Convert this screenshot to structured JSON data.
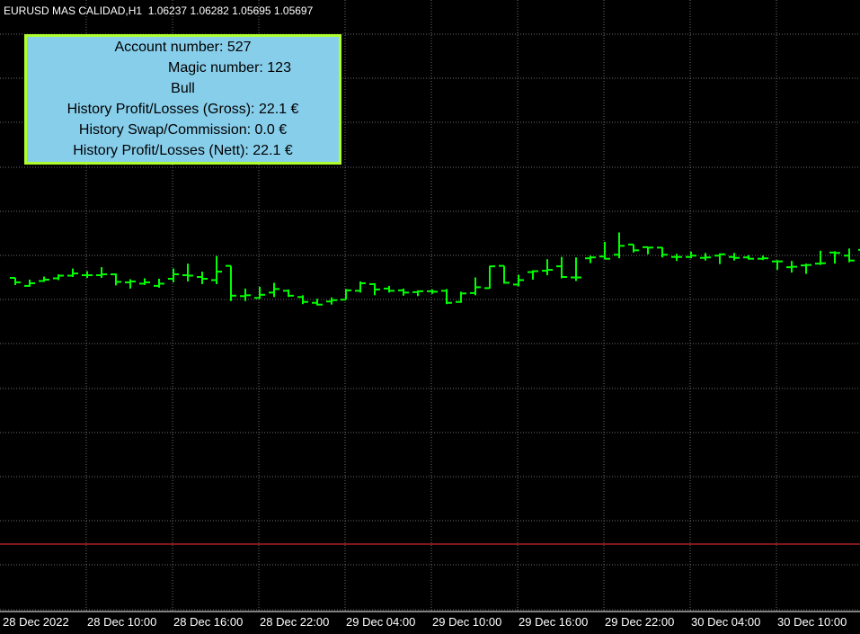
{
  "header": {
    "symbol_timeframe": "EURUSD MAS CALIDAD,H1",
    "open": "1.06237",
    "high": "1.06282",
    "low": "1.05695",
    "close": "1.05697"
  },
  "info_panel": {
    "lines": [
      "Account number: 527",
      "Magic number: 123",
      "Bull",
      "History Profit/Losses (Gross): 22.1 €",
      "History Swap/Commission: 0.0 €",
      "History Profit/Losses (Nett): 22.1 €"
    ]
  },
  "time_axis": {
    "labels": [
      "28 Dec 2022",
      "28 Dec 10:00",
      "28 Dec 16:00",
      "28 Dec 22:00",
      "29 Dec 04:00",
      "29 Dec 10:00",
      "29 Dec 16:00",
      "29 Dec 22:00",
      "30 Dec 04:00",
      "30 Dec 10:00"
    ]
  },
  "colors": {
    "background": "#000000",
    "bar": "#00ff00",
    "grid": "#6e6e6e",
    "text": "#ffffff",
    "panel_bg": "#87ceeb",
    "panel_border": "#adff2f",
    "price_line": "#ff3030"
  },
  "chart_data": {
    "type": "ohlc",
    "symbol": "EURUSD MAS CALIDAD",
    "timeframe": "H1",
    "bars": [
      {
        "o": 1.065,
        "h": 1.065,
        "l": 1.0634,
        "c": 1.064
      },
      {
        "o": 1.0632,
        "h": 1.0646,
        "l": 1.063,
        "c": 1.0638
      },
      {
        "o": 1.0643,
        "h": 1.0653,
        "l": 1.0641,
        "c": 1.0646
      },
      {
        "o": 1.0649,
        "h": 1.0658,
        "l": 1.0645,
        "c": 1.0655
      },
      {
        "o": 1.0655,
        "h": 1.0671,
        "l": 1.0652,
        "c": 1.066
      },
      {
        "o": 1.0656,
        "h": 1.0665,
        "l": 1.065,
        "c": 1.0656
      },
      {
        "o": 1.0656,
        "h": 1.0674,
        "l": 1.065,
        "c": 1.0658
      },
      {
        "o": 1.0658,
        "h": 1.066,
        "l": 1.0633,
        "c": 1.0641
      },
      {
        "o": 1.064,
        "h": 1.0647,
        "l": 1.0626,
        "c": 1.0642
      },
      {
        "o": 1.0637,
        "h": 1.0649,
        "l": 1.0634,
        "c": 1.064
      },
      {
        "o": 1.0632,
        "h": 1.0648,
        "l": 1.0628,
        "c": 1.0637
      },
      {
        "o": 1.0648,
        "h": 1.0671,
        "l": 1.064,
        "c": 1.0658
      },
      {
        "o": 1.0656,
        "h": 1.0682,
        "l": 1.0642,
        "c": 1.0655
      },
      {
        "o": 1.0652,
        "h": 1.0664,
        "l": 1.0636,
        "c": 1.0648
      },
      {
        "o": 1.0645,
        "h": 1.0699,
        "l": 1.0636,
        "c": 1.0664
      },
      {
        "o": 1.0677,
        "h": 1.0677,
        "l": 1.0598,
        "c": 1.061
      },
      {
        "o": 1.0609,
        "h": 1.0626,
        "l": 1.0598,
        "c": 1.0611
      },
      {
        "o": 1.0605,
        "h": 1.063,
        "l": 1.0603,
        "c": 1.0612
      },
      {
        "o": 1.0617,
        "h": 1.0639,
        "l": 1.0607,
        "c": 1.0625
      },
      {
        "o": 1.0621,
        "h": 1.0624,
        "l": 1.0607,
        "c": 1.061
      },
      {
        "o": 1.0607,
        "h": 1.0611,
        "l": 1.0591,
        "c": 1.0596
      },
      {
        "o": 1.0594,
        "h": 1.0603,
        "l": 1.0588,
        "c": 1.059
      },
      {
        "o": 1.0597,
        "h": 1.0606,
        "l": 1.059,
        "c": 1.06
      },
      {
        "o": 1.0601,
        "h": 1.0625,
        "l": 1.0601,
        "c": 1.0622
      },
      {
        "o": 1.0621,
        "h": 1.0642,
        "l": 1.0617,
        "c": 1.0638
      },
      {
        "o": 1.0636,
        "h": 1.0638,
        "l": 1.0611,
        "c": 1.0624
      },
      {
        "o": 1.0626,
        "h": 1.0632,
        "l": 1.0617,
        "c": 1.0621
      },
      {
        "o": 1.0622,
        "h": 1.0626,
        "l": 1.061,
        "c": 1.0617
      },
      {
        "o": 1.0618,
        "h": 1.0622,
        "l": 1.0609,
        "c": 1.062
      },
      {
        "o": 1.062,
        "h": 1.0624,
        "l": 1.0614,
        "c": 1.0619
      },
      {
        "o": 1.0621,
        "h": 1.0625,
        "l": 1.0591,
        "c": 1.0594
      },
      {
        "o": 1.0596,
        "h": 1.0619,
        "l": 1.0594,
        "c": 1.0615
      },
      {
        "o": 1.0616,
        "h": 1.0651,
        "l": 1.0611,
        "c": 1.0629
      },
      {
        "o": 1.0627,
        "h": 1.0677,
        "l": 1.0626,
        "c": 1.0676
      },
      {
        "o": 1.0677,
        "h": 1.0677,
        "l": 1.0637,
        "c": 1.0639
      },
      {
        "o": 1.0635,
        "h": 1.0657,
        "l": 1.0631,
        "c": 1.0645
      },
      {
        "o": 1.0663,
        "h": 1.0667,
        "l": 1.0646,
        "c": 1.0665
      },
      {
        "o": 1.0666,
        "h": 1.0692,
        "l": 1.0656,
        "c": 1.0668
      },
      {
        "o": 1.0676,
        "h": 1.0697,
        "l": 1.0649,
        "c": 1.0652
      },
      {
        "o": 1.0651,
        "h": 1.0696,
        "l": 1.0643,
        "c": 1.0651
      },
      {
        "o": 1.0694,
        "h": 1.07,
        "l": 1.0683,
        "c": 1.0696
      },
      {
        "o": 1.0698,
        "h": 1.0731,
        "l": 1.0692,
        "c": 1.0693
      },
      {
        "o": 1.0702,
        "h": 1.0752,
        "l": 1.0694,
        "c": 1.0722
      },
      {
        "o": 1.0725,
        "h": 1.0725,
        "l": 1.0707,
        "c": 1.0712
      },
      {
        "o": 1.0719,
        "h": 1.0719,
        "l": 1.0703,
        "c": 1.0718
      },
      {
        "o": 1.0718,
        "h": 1.0719,
        "l": 1.0696,
        "c": 1.0702
      },
      {
        "o": 1.0697,
        "h": 1.0704,
        "l": 1.0688,
        "c": 1.0697
      },
      {
        "o": 1.0697,
        "h": 1.0709,
        "l": 1.0694,
        "c": 1.07
      },
      {
        "o": 1.0695,
        "h": 1.0706,
        "l": 1.0689,
        "c": 1.0696
      },
      {
        "o": 1.07,
        "h": 1.0705,
        "l": 1.0681,
        "c": 1.0703
      },
      {
        "o": 1.0697,
        "h": 1.0706,
        "l": 1.0689,
        "c": 1.0695
      },
      {
        "o": 1.0696,
        "h": 1.0701,
        "l": 1.0691,
        "c": 1.0693
      },
      {
        "o": 1.0693,
        "h": 1.07,
        "l": 1.069,
        "c": 1.0694
      },
      {
        "o": 1.0687,
        "h": 1.069,
        "l": 1.0668,
        "c": 1.0687
      },
      {
        "o": 1.0674,
        "h": 1.0688,
        "l": 1.0662,
        "c": 1.0675
      },
      {
        "o": 1.0678,
        "h": 1.0682,
        "l": 1.0659,
        "c": 1.0679
      },
      {
        "o": 1.0682,
        "h": 1.0711,
        "l": 1.0679,
        "c": 1.0683
      },
      {
        "o": 1.0707,
        "h": 1.071,
        "l": 1.0682,
        "c": 1.0706
      },
      {
        "o": 1.07,
        "h": 1.0716,
        "l": 1.0685,
        "c": 1.0689
      },
      {
        "o": 1.0713,
        "h": 1.075,
        "l": 1.0701,
        "c": 1.0713
      },
      {
        "o": 1.0722,
        "h": 1.0762,
        "l": 1.0716,
        "c": 1.0724
      },
      {
        "o": 1.0731,
        "h": 1.0742,
        "l": 1.0718,
        "c": 1.073
      }
    ]
  }
}
